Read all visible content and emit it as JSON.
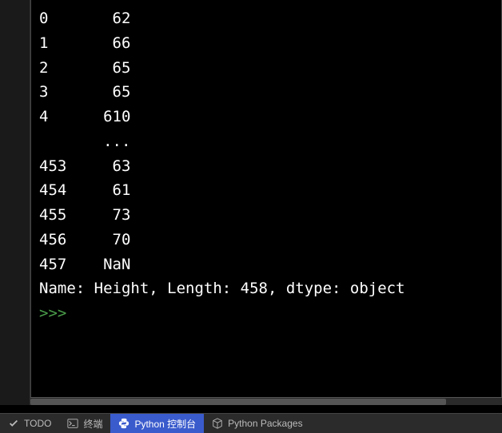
{
  "output": {
    "rows": [
      {
        "index": "0",
        "value": "62"
      },
      {
        "index": "1",
        "value": "66"
      },
      {
        "index": "2",
        "value": "65"
      },
      {
        "index": "3",
        "value": "65"
      },
      {
        "index": "4",
        "value": "610"
      },
      {
        "index": "",
        "value": "..."
      },
      {
        "index": "453",
        "value": "63"
      },
      {
        "index": "454",
        "value": "61"
      },
      {
        "index": "455",
        "value": "73"
      },
      {
        "index": "456",
        "value": "70"
      },
      {
        "index": "457",
        "value": "NaN"
      }
    ],
    "summary": "Name: Height, Length: 458, dtype: object",
    "prompt": ">>> "
  },
  "toolbar": {
    "todo": "TODO",
    "terminal": "终端",
    "python_console": "Python 控制台",
    "python_packages": "Python Packages"
  }
}
